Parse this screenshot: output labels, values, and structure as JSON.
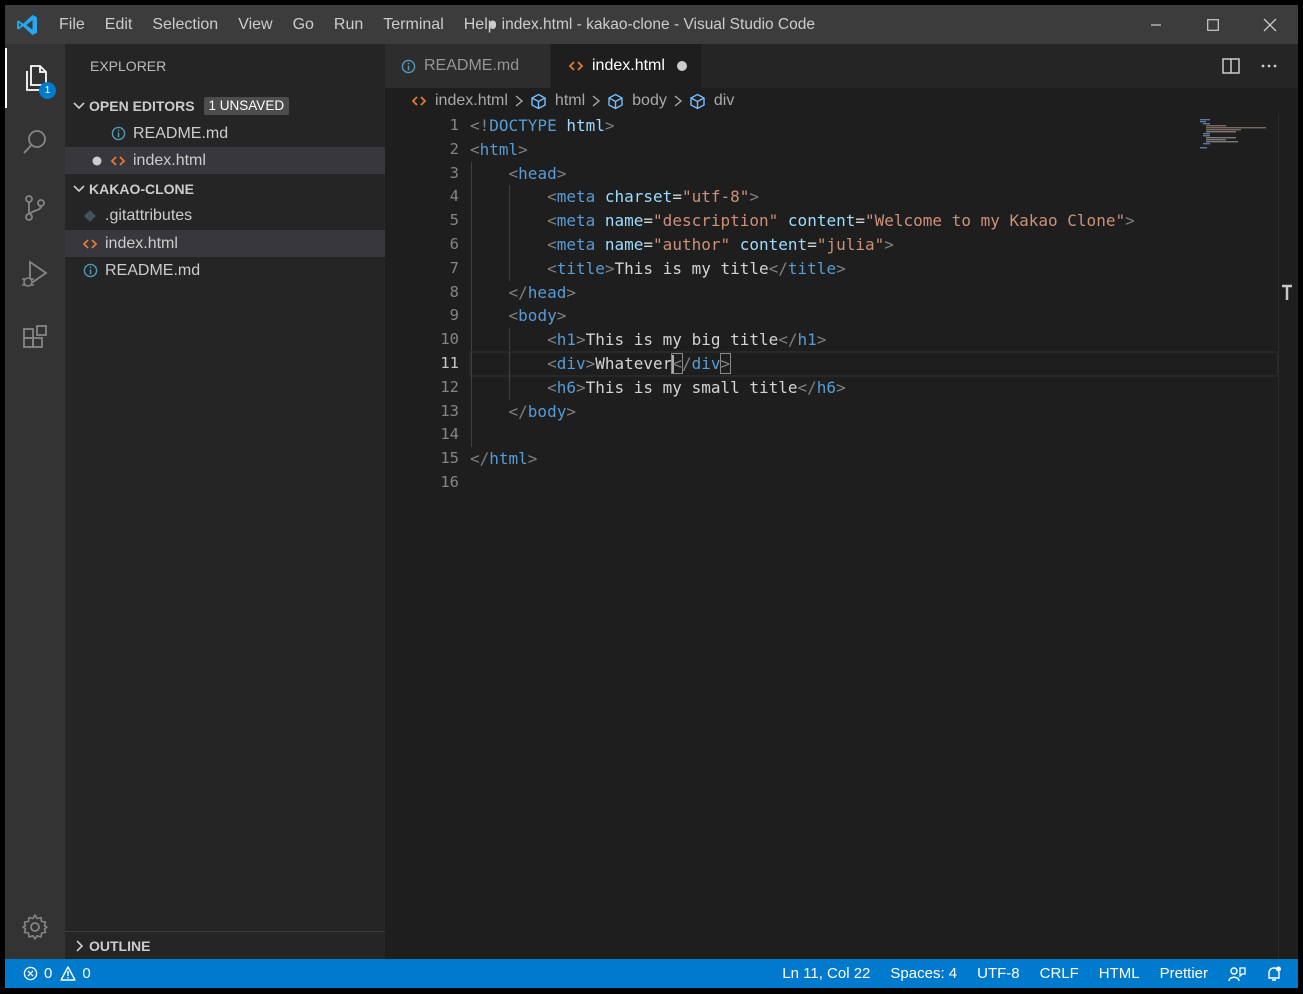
{
  "window": {
    "title": "● index.html - kakao-clone - Visual Studio Code"
  },
  "menu": [
    "File",
    "Edit",
    "Selection",
    "View",
    "Go",
    "Run",
    "Terminal",
    "Help"
  ],
  "activity": {
    "explorer_badge": "1"
  },
  "sidebar": {
    "title": "EXPLORER",
    "open_editors": {
      "label": "OPEN EDITORS",
      "badge": "1 UNSAVED",
      "items": [
        {
          "name": "README.md",
          "icon": "info-icon"
        },
        {
          "name": "index.html",
          "icon": "html-icon",
          "dirty": true
        }
      ]
    },
    "folder": {
      "label": "KAKAO-CLONE",
      "items": [
        {
          "name": ".gitattributes",
          "icon": "git-icon"
        },
        {
          "name": "index.html",
          "icon": "html-icon"
        },
        {
          "name": "README.md",
          "icon": "info-icon"
        }
      ]
    },
    "outline_label": "OUTLINE"
  },
  "tabs": [
    {
      "label": "README.md",
      "icon": "info-icon",
      "active": false
    },
    {
      "label": "index.html",
      "icon": "html-icon",
      "active": true,
      "dirty": true
    }
  ],
  "breadcrumb": [
    "index.html",
    "html",
    "body",
    "div"
  ],
  "editor": {
    "line_numbers": [
      "1",
      "2",
      "3",
      "4",
      "5",
      "6",
      "7",
      "8",
      "9",
      "10",
      "11",
      "12",
      "13",
      "14",
      "15",
      "16"
    ],
    "current_line": 11
  },
  "status": {
    "errors": "0",
    "warnings": "0",
    "position": "Ln 11, Col 22",
    "spaces": "Spaces: 4",
    "encoding": "UTF-8",
    "eol": "CRLF",
    "language": "HTML",
    "formatter": "Prettier"
  },
  "colors": {
    "accent": "#007acc",
    "html_icon": "#e37933",
    "info_icon": "#519aba",
    "tag": "#569cd6",
    "attribute": "#9cdcfe",
    "string": "#ce9178"
  }
}
